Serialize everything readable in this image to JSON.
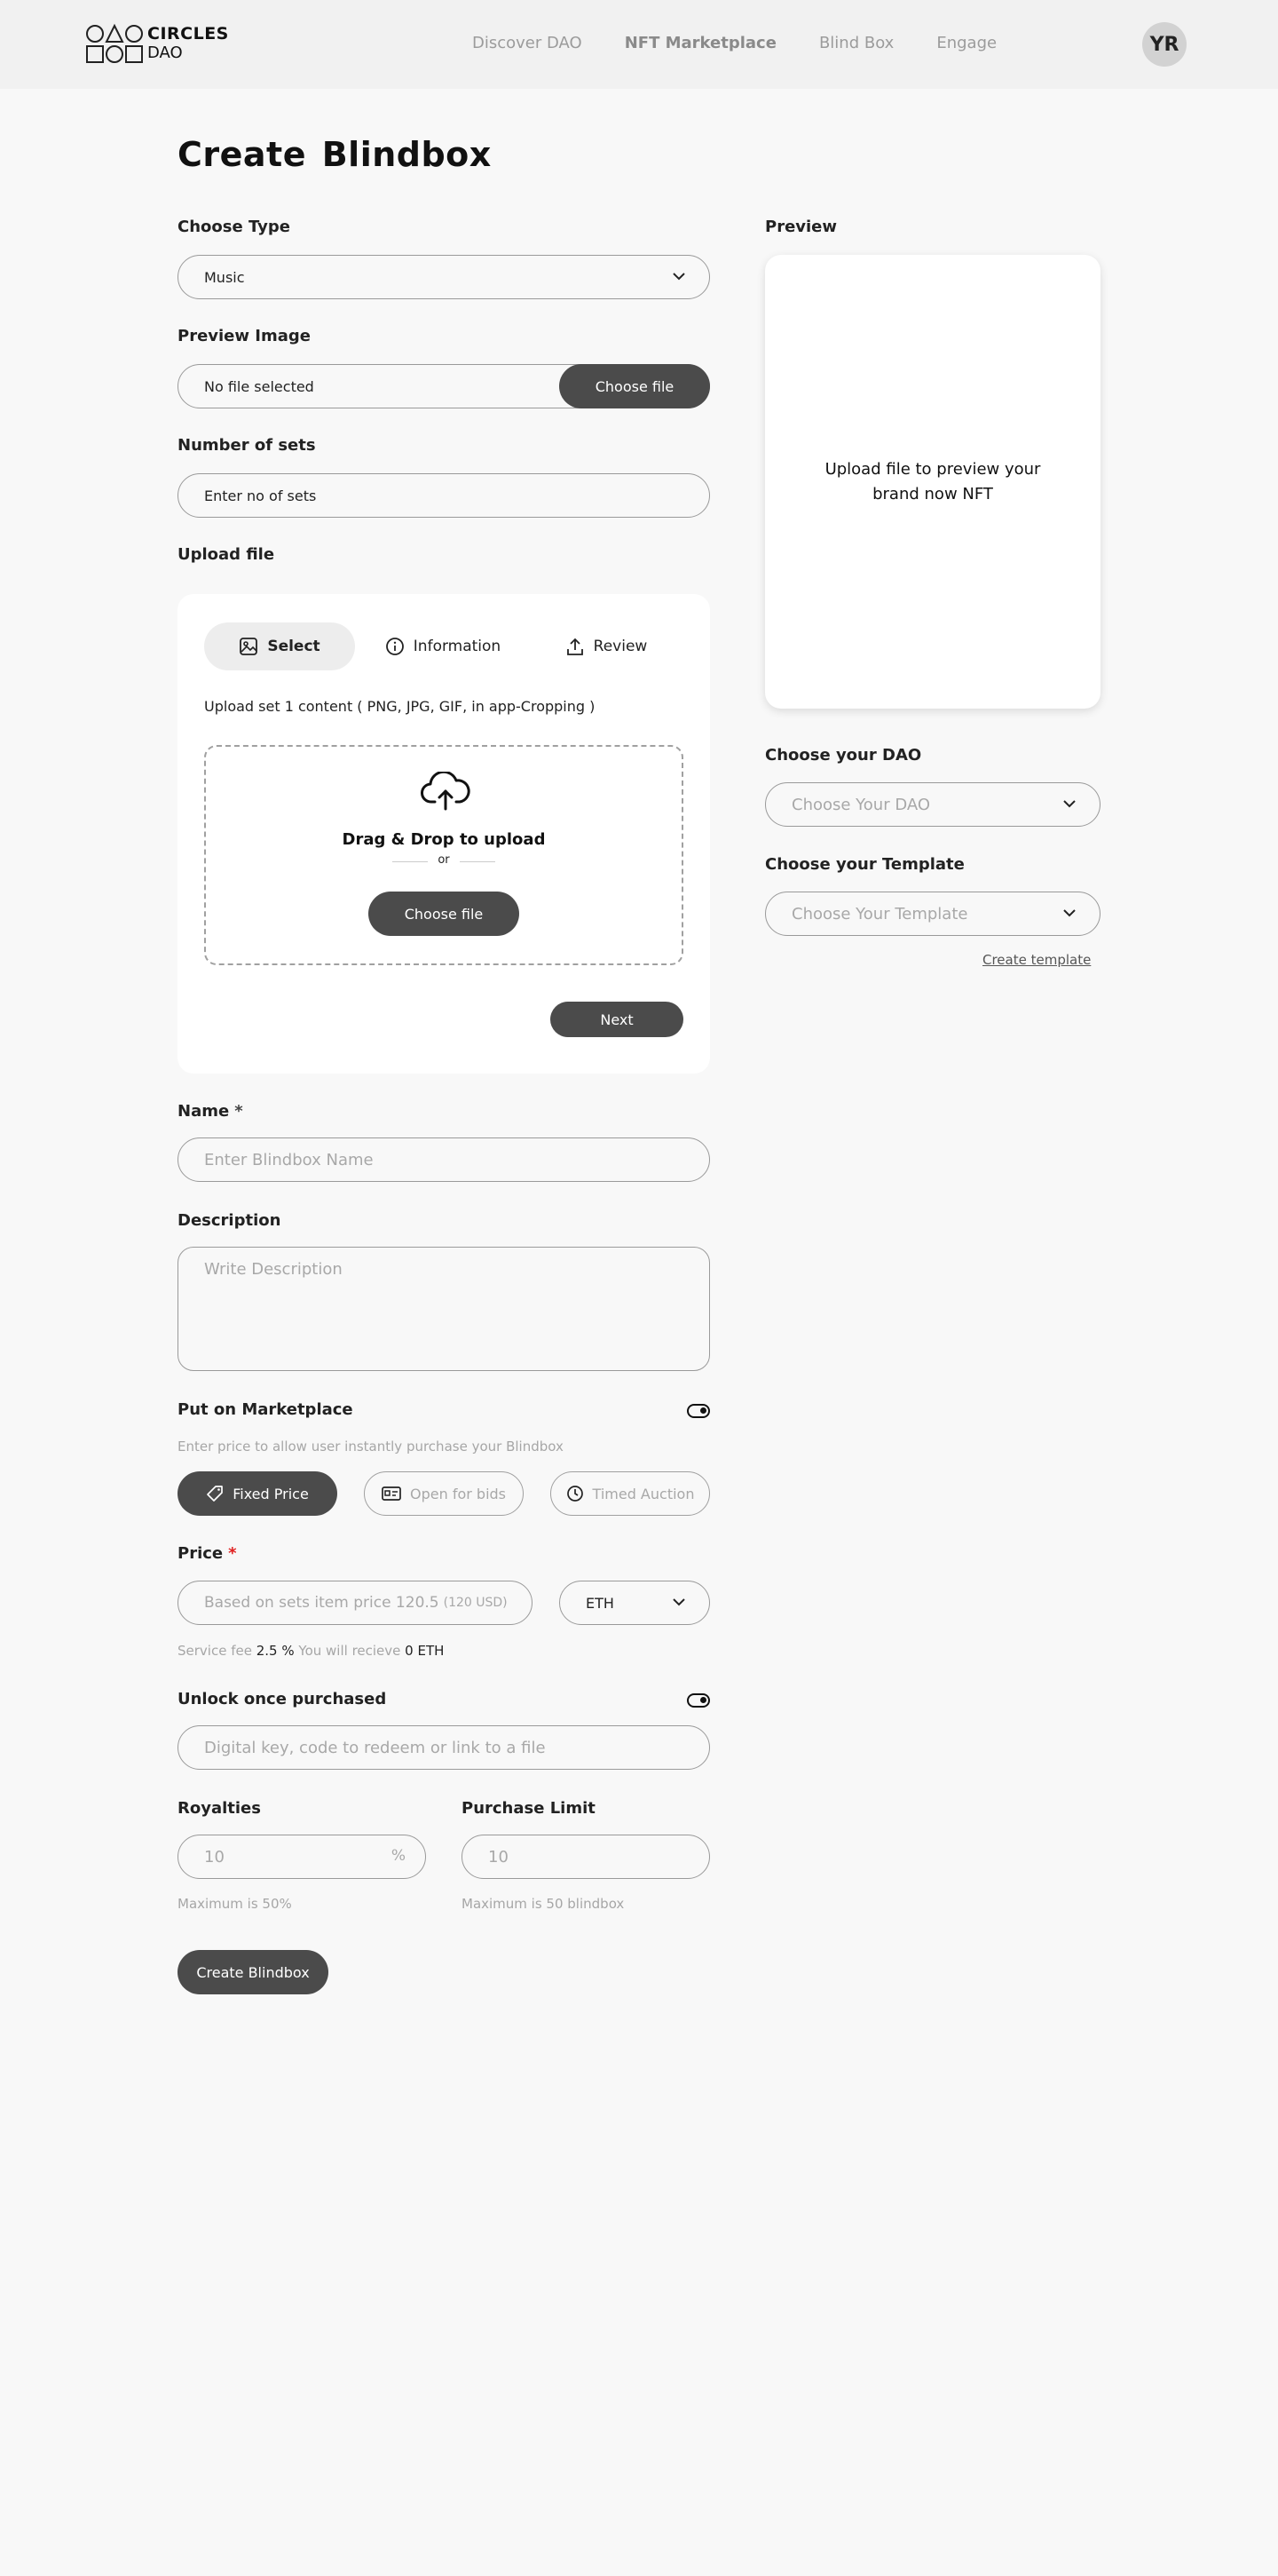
{
  "header": {
    "logo_line1": "CIRCLES",
    "logo_line2": "DAO",
    "nav": [
      "Discover DAO",
      "NFT Marketplace",
      "Blind Box",
      "Engage"
    ],
    "avatar": "YR"
  },
  "page_title": "Create  Blindbox",
  "choose_type": {
    "label": "Choose Type",
    "value": "Music"
  },
  "preview_image": {
    "label": "Preview Image",
    "status": "No file selected",
    "button": "Choose file"
  },
  "number_of_sets": {
    "label": "Number of sets",
    "placeholder": "Enter no of sets"
  },
  "upload": {
    "label": "Upload file",
    "tabs": [
      "Select",
      "Information",
      "Review"
    ],
    "content_note": "Upload set 1 content ( PNG, JPG, GIF, in app-Cropping )",
    "drag_text": "Drag & Drop to upload",
    "or_text": "or",
    "choose_button": "Choose file",
    "next_button": "Next"
  },
  "name": {
    "label": "Name",
    "required_mark": "*",
    "placeholder": "Enter Blindbox Name"
  },
  "description": {
    "label": "Description",
    "placeholder": "Write Description"
  },
  "marketplace": {
    "label": "Put on Marketplace",
    "hint": "Enter price to allow user instantly purchase your Blindbox",
    "modes": [
      "Fixed Price",
      "Open for bids",
      "Timed Auction"
    ],
    "toggle_on": true
  },
  "price": {
    "label": "Price",
    "required_mark": "*",
    "placeholder": "Based on sets item price 120.5",
    "placeholder_usd": "(120 USD)",
    "currency": "ETH",
    "fee_label": "Service fee",
    "fee_value": "2.5 %",
    "receive_label": "You will recieve",
    "receive_value": "0 ETH"
  },
  "unlock": {
    "label": "Unlock once purchased",
    "placeholder": "Digital key, code to redeem or link to a file",
    "toggle_on": true
  },
  "royalties": {
    "label": "Royalties",
    "placeholder": "10",
    "suffix": "%",
    "hint": "Maximum is 50%"
  },
  "purchase_limit": {
    "label": "Purchase Limit",
    "placeholder": "10",
    "hint": "Maximum is 50 blindbox"
  },
  "submit": "Create Blindbox",
  "preview": {
    "label": "Preview",
    "text": "Upload file to preview your brand now NFT"
  },
  "dao": {
    "label": "Choose your DAO",
    "placeholder": "Choose Your DAO"
  },
  "template": {
    "label": "Choose your Template",
    "placeholder": "Choose Your Template",
    "create_link": "Create template"
  },
  "colors": {
    "dark_button": "#4b4b4b",
    "background": "#f8f8f8",
    "required": "#e02020"
  }
}
